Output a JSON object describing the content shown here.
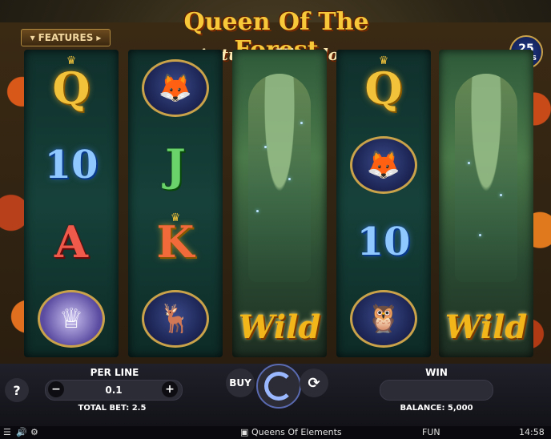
{
  "game": {
    "title_line1": "Queen Of The Forest",
    "title_line2": "Autumn Kingdom",
    "features_label": "FEATURES",
    "lines_count": "25",
    "lines_label": "LINES"
  },
  "reels": [
    {
      "symbols": [
        {
          "kind": "letter",
          "text": "Q",
          "style": "gold",
          "crown": true
        },
        {
          "kind": "letter",
          "text": "10",
          "style": "blue"
        },
        {
          "kind": "letter",
          "text": "A",
          "style": "red"
        },
        {
          "kind": "icon",
          "icon": "crystal-tiara-icon",
          "glyph": "♕"
        }
      ]
    },
    {
      "symbols": [
        {
          "kind": "icon",
          "icon": "fox-icon",
          "glyph": "🦊"
        },
        {
          "kind": "letter",
          "text": "J",
          "style": "green"
        },
        {
          "kind": "letter",
          "text": "K",
          "style": "gold",
          "crown": true
        },
        {
          "kind": "icon",
          "icon": "deer-icon",
          "glyph": "🦌"
        }
      ]
    },
    {
      "wild": true,
      "wild_text": "Wild"
    },
    {
      "symbols": [
        {
          "kind": "letter",
          "text": "Q",
          "style": "gold",
          "crown": true
        },
        {
          "kind": "icon",
          "icon": "fox-icon",
          "glyph": "🦊"
        },
        {
          "kind": "letter",
          "text": "10",
          "style": "blue"
        },
        {
          "kind": "icon",
          "icon": "owl-icon",
          "glyph": "🦉"
        }
      ]
    },
    {
      "wild": true,
      "wild_text": "Wild"
    }
  ],
  "controls": {
    "help_label": "?",
    "per_line_label": "PER LINE",
    "per_line_value": "0.1",
    "minus_label": "−",
    "plus_label": "+",
    "total_bet": "TOTAL BET: 2.5",
    "buy_label": "BUY",
    "win_label": "WIN",
    "win_value": "",
    "balance": "BALANCE: 5,000"
  },
  "statusbar": {
    "provider": "Queens Of Elements",
    "mode": "FUN",
    "time": "14:58"
  },
  "colors": {
    "accent_gold": "#f2c23a",
    "control_bg": "#2c2c36"
  }
}
